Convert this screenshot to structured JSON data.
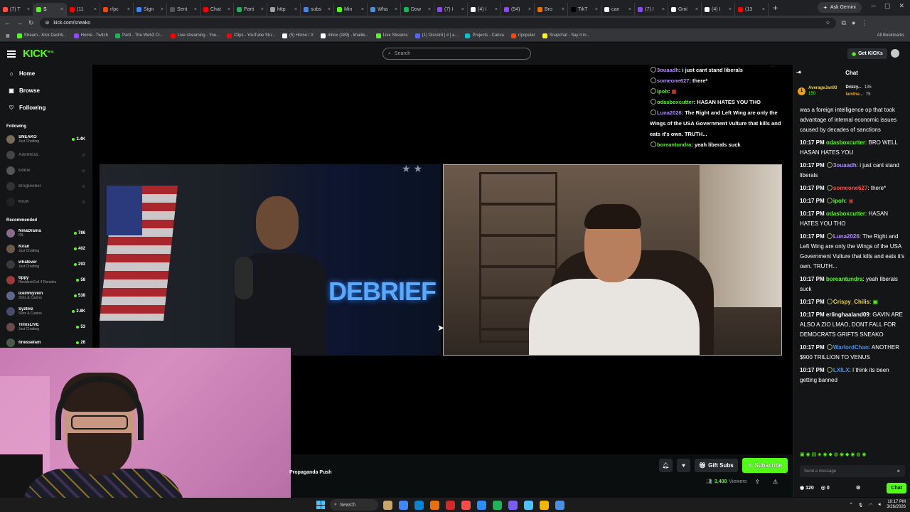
{
  "browser": {
    "tabs": [
      {
        "label": "(7) T",
        "color": "#ff4e45"
      },
      {
        "label": "S",
        "color": "#53fc18",
        "active": true
      },
      {
        "label": "(11",
        "color": "#ff0000"
      },
      {
        "label": "r/pc",
        "color": "#ff4500"
      },
      {
        "label": "Sign",
        "color": "#4285f4"
      },
      {
        "label": "Sent",
        "color": "#555555"
      },
      {
        "label": "Chat",
        "color": "#ff0000"
      },
      {
        "label": "Parti",
        "color": "#1fb25a"
      },
      {
        "label": "http",
        "color": "#9aa0a6"
      },
      {
        "label": "subs",
        "color": "#4285f4"
      },
      {
        "label": "Min",
        "color": "#53fc18"
      },
      {
        "label": "Wha",
        "color": "#4a90e2"
      },
      {
        "label": "Dow",
        "color": "#1fb25a"
      },
      {
        "label": "(7) I",
        "color": "#9146ff"
      },
      {
        "label": "(4) I",
        "color": "#ffffff"
      },
      {
        "label": "(54)",
        "color": "#9146ff"
      },
      {
        "label": "Bro",
        "color": "#e8710a"
      },
      {
        "label": "TikT",
        "color": "#000000"
      },
      {
        "label": "can",
        "color": "#ffffff"
      },
      {
        "label": "(7) I",
        "color": "#9146ff"
      },
      {
        "label": "Gmi",
        "color": "#ffffff"
      },
      {
        "label": "(4) I",
        "color": "#ffffff"
      },
      {
        "label": "(13",
        "color": "#ff0000"
      }
    ],
    "new_tab": "+",
    "ask_gemini": "Ask Gemini",
    "url": "kick.com/sneako",
    "bookmarks": [
      "Stream - Kick Dashb...",
      "Home - Twitch",
      "Parti - The Web3 Cr...",
      "Live streaming - You...",
      "Clips - YouTube Stu...",
      "(5) Home / X",
      "Inbox (189) - khalile...",
      "Live Streams",
      "(1) Discord | # | a...",
      "Projects - Canva",
      "r/popular",
      "Snapchat - Say it in..."
    ],
    "all_bookmarks": "All Bookmarks"
  },
  "header": {
    "logo": "KICK",
    "search_placeholder": "Search",
    "get_kicks": "Get KICKs"
  },
  "sidebar": {
    "nav": [
      {
        "label": "Home",
        "icon": "home-icon",
        "glyph": "⌂"
      },
      {
        "label": "Browse",
        "icon": "browse-icon",
        "glyph": "▣"
      },
      {
        "label": "Following",
        "icon": "heart-icon",
        "glyph": "♡"
      }
    ],
    "following_title": "Following",
    "following": [
      {
        "name": "SNEAKO",
        "category": "Just Chatting",
        "viewers": "3.4K",
        "live": true,
        "color": "#7a6a5a"
      },
      {
        "name": "AdinRoss",
        "category": "",
        "viewers": "",
        "live": false,
        "color": "#444444"
      },
      {
        "name": "Eddie",
        "category": "",
        "viewers": "",
        "live": false,
        "color": "#555555"
      },
      {
        "name": "brugtoober",
        "category": "",
        "viewers": "",
        "live": false,
        "color": "#333333"
      },
      {
        "name": "KICK",
        "category": "",
        "viewers": "",
        "live": false,
        "color": "#222222"
      }
    ],
    "recommended_title": "Recommended",
    "recommended": [
      {
        "name": "NinaDrama",
        "category": "IRL",
        "viewers": "786",
        "color": "#8a6a8a"
      },
      {
        "name": "Kiran",
        "category": "Just Chatting",
        "viewers": "402",
        "color": "#6a5a4a"
      },
      {
        "name": "whatever",
        "category": "Just Chatting",
        "viewers": "293",
        "color": "#3a3a3a"
      },
      {
        "name": "tippy",
        "category": "Resident Evil 4 Remake",
        "viewers": "58",
        "color": "#9a3a3a"
      },
      {
        "name": "iceinmyvein",
        "category": "Slots & Casino",
        "viewers": "538",
        "color": "#5a6a8a"
      },
      {
        "name": "Syztmz",
        "category": "Slots & Casino",
        "viewers": "2.8K",
        "color": "#4a4a6a"
      },
      {
        "name": "TimisLIVE",
        "category": "Just Chatting",
        "viewers": "53",
        "color": "#6a4a4a"
      },
      {
        "name": "finessefam",
        "category": "",
        "viewers": "26",
        "color": "#4a5a4a"
      }
    ]
  },
  "video": {
    "logo_text": "DEBRIEF",
    "overlay_chat": [
      {
        "user": "3ouaadh",
        "color": "#b48cff",
        "text": "i just cant stand liberals"
      },
      {
        "user": "someone627",
        "color": "#b48cff",
        "text": "there*"
      },
      {
        "user": "ipoh",
        "color": "#53fc18",
        "text": ""
      },
      {
        "user": "odasboxcutter",
        "color": "#53fc18",
        "text": "HASAN HATES YOU THO"
      },
      {
        "user": "Luna2026",
        "color": "#b48cff",
        "text": "The Right and Left Wing are only the Wings of the USA Government Vulture that kills and eats it's own. TRUTH..."
      },
      {
        "user": "boreantundra",
        "color": "#53fc18",
        "text": "yeah liberals suck"
      }
    ]
  },
  "stream": {
    "title": "Propaganda Push",
    "gift_subs": "Gift Subs",
    "subscribe": "Subscribe",
    "viewers": "3,408",
    "viewers_label": "Viewers"
  },
  "chat": {
    "title": "Chat",
    "leaderboard": [
      {
        "name": "AverageJan93",
        "score": "150"
      },
      {
        "name": "Drizzy...",
        "score": "135"
      },
      {
        "name": "lamtha...",
        "score": "75"
      }
    ],
    "top_fragment": "was a foreign intelligence op that took advantage of internal economic issues caused by decades of sanctions",
    "messages": [
      {
        "time": "10:17 PM",
        "user": "odasboxcutter",
        "color": "#53fc18",
        "badge": false,
        "text": "BRO WELL HASAN HATES YOU"
      },
      {
        "time": "10:17 PM",
        "user": "3ouaadh",
        "color": "#b48cff",
        "badge": true,
        "text": "i just cant stand liberals"
      },
      {
        "time": "10:17 PM",
        "user": "someone627",
        "color": "#ff4e45",
        "badge": true,
        "text": "there*"
      },
      {
        "time": "10:17 PM",
        "user": "ipoh",
        "color": "#53fc18",
        "badge": true,
        "text": ""
      },
      {
        "time": "10:17 PM",
        "user": "odasboxcutter",
        "color": "#53fc18",
        "badge": false,
        "text": "HASAN HATES YOU THO"
      },
      {
        "time": "10:17 PM",
        "user": "Luna2026",
        "color": "#b48cff",
        "badge": true,
        "text": "The Right and Left Wing are only the Wings of the USA Government Vulture that kills and eats it's own. TRUTH..."
      },
      {
        "time": "10:17 PM",
        "user": "boreantundra",
        "color": "#53fc18",
        "badge": false,
        "text": "yeah liberals suck"
      },
      {
        "time": "10:17 PM",
        "user": "Crispy_Chilis",
        "color": "#e9d34d",
        "badge": true,
        "text": ""
      },
      {
        "time": "10:17 PM",
        "user": "erlinghaaland09",
        "color": "#ffffff",
        "badge": false,
        "text": "GAVIN ARE ALSO A ZIO LMAO, DONT FALL FOR DEMOCRATS GRIFTS SNEAKO"
      },
      {
        "time": "10:17 PM",
        "user": "WarlordChan",
        "color": "#4a90e2",
        "badge": true,
        "text": "ANOTHER $900 TRILLION TO VENUS"
      },
      {
        "time": "10:17 PM",
        "user": "LXILX",
        "color": "#4a90e2",
        "badge": true,
        "text": "I think its been getting banned"
      }
    ],
    "input_placeholder": "Send a message",
    "kicks_count": "120",
    "points_count": "0",
    "send_label": "Chat"
  },
  "taskbar": {
    "search": "Search",
    "apps": [
      "#c9a56a",
      "#4285f4",
      "#0a84d0",
      "#e8710a",
      "#d02a2a",
      "#ff4b4b",
      "#2d8cff",
      "#1fb25a",
      "#7a5cff",
      "#4cc2ff",
      "#f4b400",
      "#4a90e2"
    ],
    "time": "10:17 PM",
    "date": "3/26/2026"
  }
}
